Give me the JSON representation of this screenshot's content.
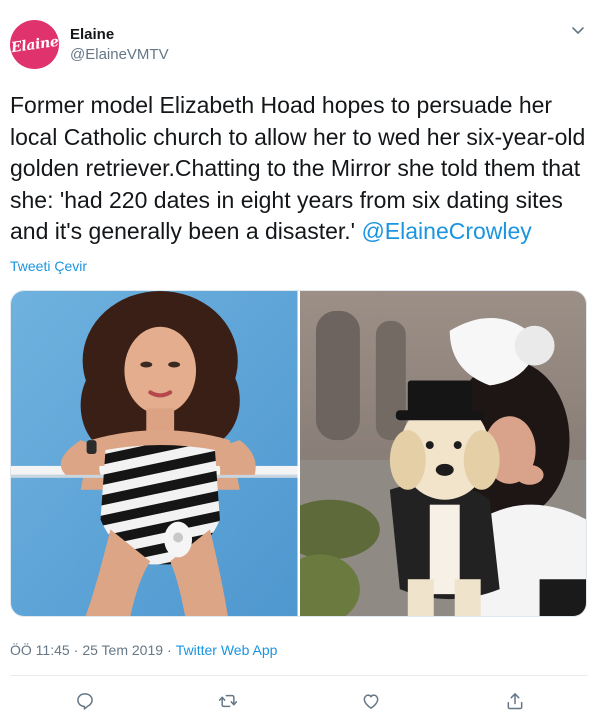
{
  "author": {
    "avatar_text": "Elaine",
    "display_name": "Elaine",
    "handle": "@ElaineVMTV"
  },
  "tweet": {
    "text": "Former model Elizabeth Hoad hopes to persuade her local Catholic church to allow her to wed her six-year-old golden retriever.Chatting to the Mirror she told them that she: 'had 220 dates in eight years from six dating sites and it's generally been a disaster.' ",
    "mention": "@ElaineCrowley",
    "translate_label": "Tweeti Çevir"
  },
  "media": {
    "photos": [
      {
        "subject": "striped swimsuit model photo"
      },
      {
        "subject": "golden retriever in top hat with woman"
      }
    ]
  },
  "meta": {
    "time": "ÖÖ 11:45",
    "separator1": "·",
    "date": "25 Tem 2019",
    "separator2": "·",
    "source": "Twitter Web App"
  },
  "actions": [
    {
      "icon": "reply-icon"
    },
    {
      "icon": "retweet-icon"
    },
    {
      "icon": "like-icon"
    },
    {
      "icon": "share-icon"
    }
  ],
  "colors": {
    "link": "#1b95e0",
    "secondary_text": "#657786",
    "primary_text": "#14171a",
    "avatar_bg": "#e0336e"
  }
}
